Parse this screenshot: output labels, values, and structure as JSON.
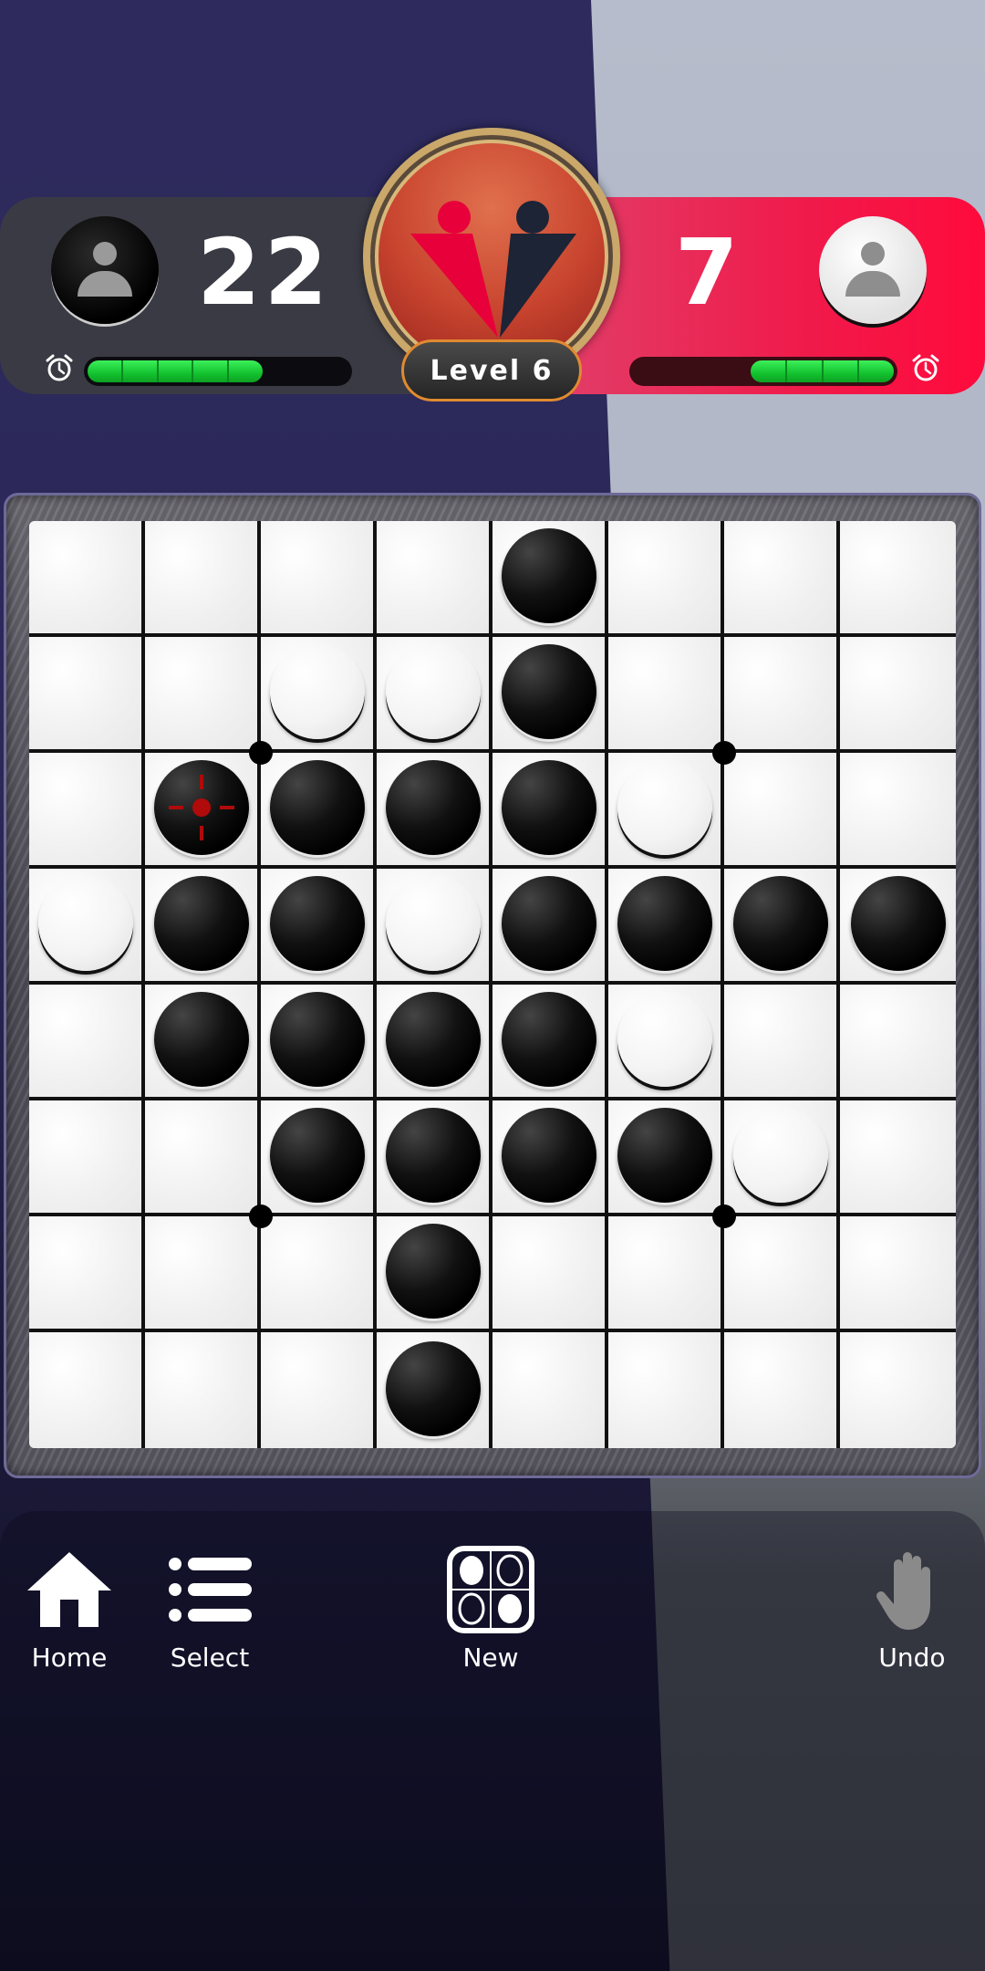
{
  "players": {
    "black": {
      "name_icon": "person-icon",
      "score": "22",
      "timer_fraction": 0.67
    },
    "white": {
      "name_icon": "person-icon",
      "score": "7",
      "timer_fraction": 0.55
    }
  },
  "level": {
    "label": "Level 6"
  },
  "colors": {
    "green_bar": "#1ed43a",
    "red_panel": "#f01a4a",
    "dark_panel": "#3a3a44",
    "badge_red": "#c8442e",
    "logo_red": "#e8003a",
    "logo_navy": "#1c2436"
  },
  "board": {
    "size": 8,
    "rows": [
      "....B...",
      "..WWB...",
      ".BBBBW..",
      "WBBWBBBB",
      ".BBBBW..",
      "..BBBBW.",
      "...B....",
      "...B...."
    ],
    "last_move": {
      "row": 2,
      "col": 1
    },
    "star_points": [
      [
        2,
        2
      ],
      [
        2,
        6
      ],
      [
        6,
        2
      ],
      [
        6,
        6
      ]
    ]
  },
  "nav": {
    "home": {
      "label": "Home",
      "icon": "home-icon"
    },
    "select": {
      "label": "Select",
      "icon": "list-icon"
    },
    "new": {
      "label": "New",
      "icon": "new-game-icon"
    },
    "undo": {
      "label": "Undo",
      "icon": "hand-icon"
    }
  }
}
